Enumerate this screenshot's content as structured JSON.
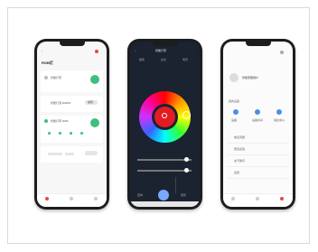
{
  "phone1": {
    "title": "RGB灯",
    "device1": {
      "name": "智能灯带"
    },
    "device2": {
      "name": "智能灯泡 RGBW",
      "action": "编辑"
    },
    "device3": {
      "name": "智能灯带 RGB",
      "action": "编辑"
    },
    "tabs": [
      "设备",
      "场景",
      "我的"
    ]
  },
  "phone2": {
    "title": "智能灯带",
    "modes": [
      "颜色",
      "白光",
      "场景"
    ],
    "accent": "#e31b23",
    "bottom": [
      "定时",
      "开关",
      "音乐"
    ]
  },
  "phone3": {
    "user": "智能家居用户",
    "section": "我的设备",
    "shortcuts": [
      "设备",
      "设备共享",
      "消息中心"
    ],
    "menu": [
      "常见问题",
      "意见反馈",
      "关于我们",
      "设置"
    ],
    "tabs": [
      "设备",
      "场景",
      "我的"
    ]
  },
  "colors": {
    "green": "#3fbf7f",
    "red": "#e84a3c",
    "dark": "#1b2230",
    "blue": "#7aa7ff"
  }
}
